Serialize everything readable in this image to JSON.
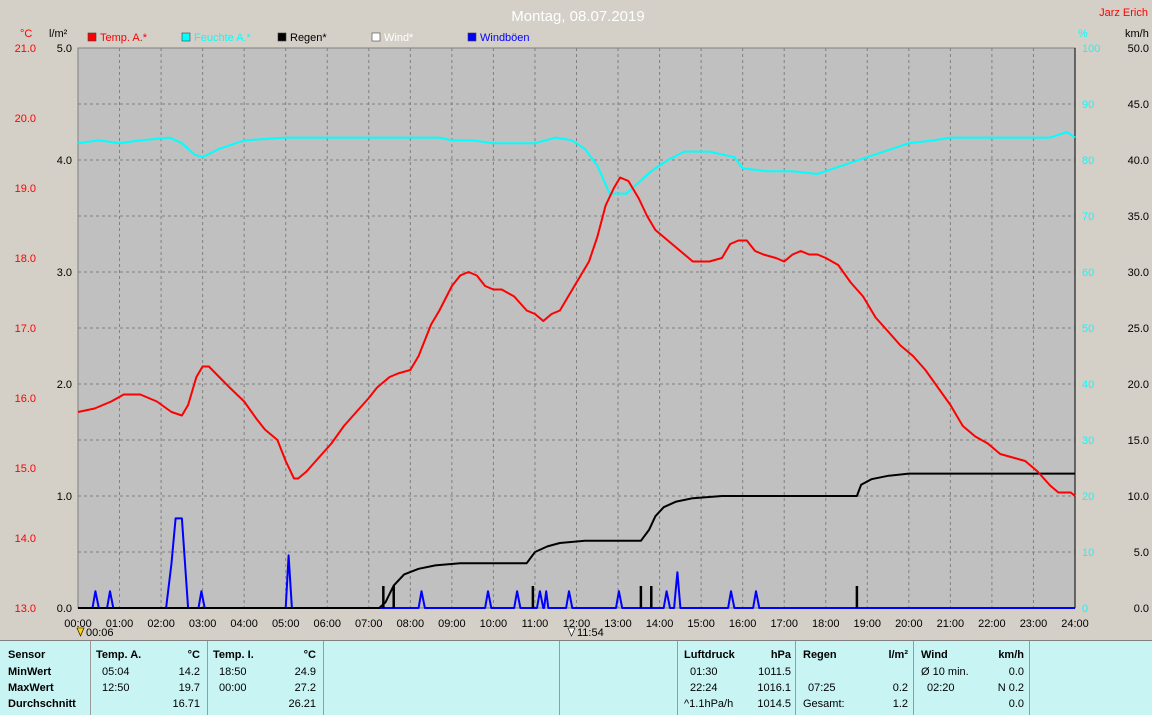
{
  "header": {
    "title": "Montag, 08.07.2019",
    "author": "Jarz Erich",
    "unit_temp": "°C",
    "unit_rain": "l/m²",
    "unit_hum": "%",
    "unit_wind": "km/h"
  },
  "legend": [
    {
      "label": "Temp. A.*",
      "color": "#ff0000"
    },
    {
      "label": "Feuchte A.*",
      "color": "#00ffff"
    },
    {
      "label": "Regen*",
      "color": "#000000"
    },
    {
      "label": "Wind*",
      "color": "#ffffff"
    },
    {
      "label": "Windböen",
      "color": "#0000ff"
    }
  ],
  "markers": {
    "left": "00:06",
    "mid": "11:54"
  },
  "chart_data": {
    "type": "line",
    "x_unit": "hours",
    "x_ticks": [
      "00:00",
      "01:00",
      "02:00",
      "03:00",
      "04:00",
      "05:00",
      "06:00",
      "07:00",
      "08:00",
      "09:00",
      "10:00",
      "11:00",
      "12:00",
      "13:00",
      "14:00",
      "15:00",
      "16:00",
      "17:00",
      "18:00",
      "19:00",
      "20:00",
      "21:00",
      "22:00",
      "23:00",
      "24:00"
    ],
    "xlim": [
      0,
      24
    ],
    "axes": {
      "temp": {
        "ticks": [
          "13.0",
          "14.0",
          "15.0",
          "16.0",
          "17.0",
          "18.0",
          "19.0",
          "20.0",
          "21.0"
        ],
        "ylim": [
          13,
          21
        ],
        "color": "#ff0000"
      },
      "rain": {
        "ticks": [
          "0.0",
          "1.0",
          "2.0",
          "3.0",
          "4.0",
          "5.0"
        ],
        "ylim": [
          0,
          5
        ],
        "color": "#000000"
      },
      "humidity": {
        "ticks": [
          "0",
          "10",
          "20",
          "30",
          "40",
          "50",
          "60",
          "70",
          "80",
          "90",
          "100"
        ],
        "ylim": [
          0,
          100
        ],
        "color": "#00ffff"
      },
      "wind": {
        "ticks": [
          "0.0",
          "5.0",
          "10.0",
          "15.0",
          "20.0",
          "25.0",
          "30.0",
          "35.0",
          "40.0",
          "45.0",
          "50.0"
        ],
        "ylim": [
          0,
          50
        ],
        "color": "#000000"
      }
    },
    "grid": true,
    "series": [
      {
        "name": "Temp. A.*",
        "axis": "temp",
        "color": "#ff0000",
        "points": [
          [
            0,
            15.8
          ],
          [
            0.4,
            15.85
          ],
          [
            0.8,
            15.95
          ],
          [
            1.1,
            16.05
          ],
          [
            1.5,
            16.05
          ],
          [
            1.9,
            15.95
          ],
          [
            2.25,
            15.8
          ],
          [
            2.5,
            15.75
          ],
          [
            2.65,
            15.9
          ],
          [
            2.85,
            16.3
          ],
          [
            3.0,
            16.45
          ],
          [
            3.15,
            16.45
          ],
          [
            3.4,
            16.3
          ],
          [
            3.65,
            16.15
          ],
          [
            4.0,
            15.95
          ],
          [
            4.3,
            15.7
          ],
          [
            4.5,
            15.55
          ],
          [
            4.8,
            15.4
          ],
          [
            5.0,
            15.1
          ],
          [
            5.2,
            14.85
          ],
          [
            5.3,
            14.85
          ],
          [
            5.5,
            14.95
          ],
          [
            5.8,
            15.15
          ],
          [
            6.1,
            15.35
          ],
          [
            6.4,
            15.6
          ],
          [
            6.7,
            15.8
          ],
          [
            7.0,
            16.0
          ],
          [
            7.2,
            16.15
          ],
          [
            7.5,
            16.3
          ],
          [
            7.7,
            16.35
          ],
          [
            8.0,
            16.4
          ],
          [
            8.2,
            16.6
          ],
          [
            8.5,
            17.05
          ],
          [
            8.7,
            17.25
          ],
          [
            9.0,
            17.6
          ],
          [
            9.2,
            17.75
          ],
          [
            9.4,
            17.8
          ],
          [
            9.6,
            17.75
          ],
          [
            9.8,
            17.6
          ],
          [
            10.0,
            17.55
          ],
          [
            10.2,
            17.55
          ],
          [
            10.5,
            17.45
          ],
          [
            10.8,
            17.25
          ],
          [
            11.0,
            17.2
          ],
          [
            11.2,
            17.1
          ],
          [
            11.4,
            17.2
          ],
          [
            11.6,
            17.25
          ],
          [
            11.8,
            17.45
          ],
          [
            12.0,
            17.65
          ],
          [
            12.3,
            17.95
          ],
          [
            12.5,
            18.3
          ],
          [
            12.7,
            18.75
          ],
          [
            12.9,
            19.0
          ],
          [
            13.05,
            19.15
          ],
          [
            13.25,
            19.1
          ],
          [
            13.5,
            18.85
          ],
          [
            13.7,
            18.6
          ],
          [
            13.9,
            18.4
          ],
          [
            14.1,
            18.3
          ],
          [
            14.3,
            18.2
          ],
          [
            14.6,
            18.05
          ],
          [
            14.8,
            17.95
          ],
          [
            15.0,
            17.95
          ],
          [
            15.2,
            17.95
          ],
          [
            15.5,
            18.0
          ],
          [
            15.7,
            18.2
          ],
          [
            15.9,
            18.25
          ],
          [
            16.1,
            18.25
          ],
          [
            16.3,
            18.1
          ],
          [
            16.5,
            18.05
          ],
          [
            16.8,
            18.0
          ],
          [
            17.0,
            17.95
          ],
          [
            17.2,
            18.05
          ],
          [
            17.4,
            18.1
          ],
          [
            17.6,
            18.05
          ],
          [
            17.8,
            18.05
          ],
          [
            18.0,
            18.0
          ],
          [
            18.3,
            17.9
          ],
          [
            18.6,
            17.65
          ],
          [
            18.9,
            17.45
          ],
          [
            19.2,
            17.15
          ],
          [
            19.5,
            16.95
          ],
          [
            19.8,
            16.75
          ],
          [
            20.1,
            16.6
          ],
          [
            20.4,
            16.4
          ],
          [
            20.7,
            16.15
          ],
          [
            21.0,
            15.9
          ],
          [
            21.3,
            15.6
          ],
          [
            21.6,
            15.45
          ],
          [
            21.9,
            15.35
          ],
          [
            22.2,
            15.2
          ],
          [
            22.5,
            15.15
          ],
          [
            22.8,
            15.1
          ],
          [
            23.1,
            14.95
          ],
          [
            23.4,
            14.75
          ],
          [
            23.6,
            14.65
          ],
          [
            23.9,
            14.65
          ],
          [
            24.0,
            14.6
          ]
        ]
      },
      {
        "name": "Feuchte A.*",
        "axis": "humidity",
        "color": "#00ffff",
        "points": [
          [
            0,
            83
          ],
          [
            0.5,
            83.5
          ],
          [
            1.0,
            83
          ],
          [
            1.5,
            83.5
          ],
          [
            2.2,
            84
          ],
          [
            2.5,
            83
          ],
          [
            2.8,
            81
          ],
          [
            3.0,
            80.5
          ],
          [
            3.4,
            82
          ],
          [
            4.0,
            83.5
          ],
          [
            5.0,
            84
          ],
          [
            6.0,
            84
          ],
          [
            7.0,
            84
          ],
          [
            8.0,
            84
          ],
          [
            8.7,
            84
          ],
          [
            9.0,
            83.5
          ],
          [
            9.5,
            83.5
          ],
          [
            10.0,
            83
          ],
          [
            11.0,
            83
          ],
          [
            11.5,
            84
          ],
          [
            11.9,
            83.5
          ],
          [
            12.2,
            82
          ],
          [
            12.5,
            79
          ],
          [
            12.8,
            74
          ],
          [
            13.2,
            74
          ],
          [
            13.5,
            76
          ],
          [
            13.8,
            78
          ],
          [
            14.2,
            80
          ],
          [
            14.6,
            81.5
          ],
          [
            15.2,
            81.5
          ],
          [
            15.8,
            80.5
          ],
          [
            16.0,
            78.5
          ],
          [
            16.6,
            78
          ],
          [
            17.2,
            78
          ],
          [
            17.8,
            77.5
          ],
          [
            18.4,
            79
          ],
          [
            19.0,
            80.5
          ],
          [
            19.6,
            82
          ],
          [
            20.0,
            83
          ],
          [
            20.6,
            83.5
          ],
          [
            21.0,
            84
          ],
          [
            22.0,
            84
          ],
          [
            22.8,
            84
          ],
          [
            23.4,
            84
          ],
          [
            23.8,
            85
          ],
          [
            24.0,
            84
          ]
        ]
      },
      {
        "name": "Regen*",
        "axis": "rain",
        "color": "#000000",
        "points": [
          [
            0,
            0
          ],
          [
            7.25,
            0
          ],
          [
            7.4,
            0.05
          ],
          [
            7.6,
            0.2
          ],
          [
            7.85,
            0.3
          ],
          [
            8.2,
            0.35
          ],
          [
            8.6,
            0.38
          ],
          [
            9.2,
            0.4
          ],
          [
            10.4,
            0.4
          ],
          [
            10.8,
            0.4
          ],
          [
            11.0,
            0.5
          ],
          [
            11.3,
            0.55
          ],
          [
            11.6,
            0.58
          ],
          [
            12.2,
            0.6
          ],
          [
            13.0,
            0.6
          ],
          [
            13.55,
            0.6
          ],
          [
            13.75,
            0.7
          ],
          [
            13.9,
            0.82
          ],
          [
            14.1,
            0.9
          ],
          [
            14.4,
            0.95
          ],
          [
            14.8,
            0.98
          ],
          [
            15.5,
            1.0
          ],
          [
            16.3,
            1.0
          ],
          [
            17.0,
            1.0
          ],
          [
            18.0,
            1.0
          ],
          [
            18.75,
            1.0
          ],
          [
            18.85,
            1.1
          ],
          [
            19.1,
            1.15
          ],
          [
            19.5,
            1.18
          ],
          [
            20.0,
            1.2
          ],
          [
            21.0,
            1.2
          ],
          [
            22.0,
            1.2
          ],
          [
            23.0,
            1.2
          ],
          [
            24.0,
            1.2
          ]
        ]
      },
      {
        "name": "Windböen",
        "axis": "wind",
        "color": "#0000ff",
        "points": [
          [
            0,
            0
          ],
          [
            0.35,
            0
          ],
          [
            0.42,
            1.5
          ],
          [
            0.5,
            0
          ],
          [
            0.7,
            0
          ],
          [
            0.77,
            1.5
          ],
          [
            0.85,
            0
          ],
          [
            2.12,
            0
          ],
          [
            2.25,
            4
          ],
          [
            2.35,
            8
          ],
          [
            2.5,
            8
          ],
          [
            2.65,
            0
          ],
          [
            2.9,
            0
          ],
          [
            2.97,
            1.5
          ],
          [
            3.05,
            0
          ],
          [
            5.0,
            0
          ],
          [
            5.07,
            4.7
          ],
          [
            5.15,
            0
          ],
          [
            8.2,
            0
          ],
          [
            8.27,
            1.5
          ],
          [
            8.35,
            0
          ],
          [
            9.8,
            0
          ],
          [
            9.87,
            1.5
          ],
          [
            9.95,
            0
          ],
          [
            10.5,
            0
          ],
          [
            10.57,
            1.5
          ],
          [
            10.65,
            0
          ],
          [
            11.05,
            0
          ],
          [
            11.12,
            1.5
          ],
          [
            11.2,
            0
          ],
          [
            11.22,
            0
          ],
          [
            11.27,
            1.5
          ],
          [
            11.32,
            0
          ],
          [
            11.75,
            0
          ],
          [
            11.82,
            1.5
          ],
          [
            11.9,
            0
          ],
          [
            12.95,
            0
          ],
          [
            13.02,
            1.5
          ],
          [
            13.1,
            0
          ],
          [
            14.1,
            0
          ],
          [
            14.17,
            1.5
          ],
          [
            14.25,
            0
          ],
          [
            14.35,
            0
          ],
          [
            14.43,
            3.2
          ],
          [
            14.5,
            0
          ],
          [
            15.65,
            0
          ],
          [
            15.72,
            1.5
          ],
          [
            15.8,
            0
          ],
          [
            16.25,
            0
          ],
          [
            16.32,
            1.5
          ],
          [
            16.4,
            0
          ],
          [
            24.0,
            0
          ]
        ]
      }
    ],
    "rain_spikes": [
      7.35,
      7.6,
      10.95,
      13.55,
      13.8,
      18.75
    ]
  },
  "stats": {
    "labels": {
      "sensor": "Sensor",
      "min": "MinWert",
      "max": "MaxWert",
      "avg": "Durchschnitt"
    },
    "temp_a": {
      "title": "Temp. A.",
      "unit": "°C",
      "min_time": "05:04",
      "min_val": "14.2",
      "max_time": "12:50",
      "max_val": "19.7",
      "avg": "16.71"
    },
    "temp_i": {
      "title": "Temp. I.",
      "unit": "°C",
      "min_time": "18:50",
      "min_val": "24.9",
      "max_time": "00:00",
      "max_val": "27.2",
      "avg": "26.21"
    },
    "pressure": {
      "title": "Luftdruck",
      "unit": "hPa",
      "min_time": "01:30",
      "min_val": "1011.5",
      "max_time": "22:24",
      "max_val": "1016.1",
      "trend_label": "^1.1hPa/h",
      "trend_val": "1014.5"
    },
    "rain": {
      "title": "Regen",
      "unit": "l/m²",
      "max_time": "07:25",
      "max_val": "0.2",
      "total_label": "Gesamt:",
      "total_val": "1.2"
    },
    "wind": {
      "title": "Wind",
      "unit": "km/h",
      "avg_label": "Ø 10 min.",
      "avg_val": "0.0",
      "max_time": "02:20",
      "max_val": "N 0.2",
      "last_val": "0.0"
    }
  }
}
